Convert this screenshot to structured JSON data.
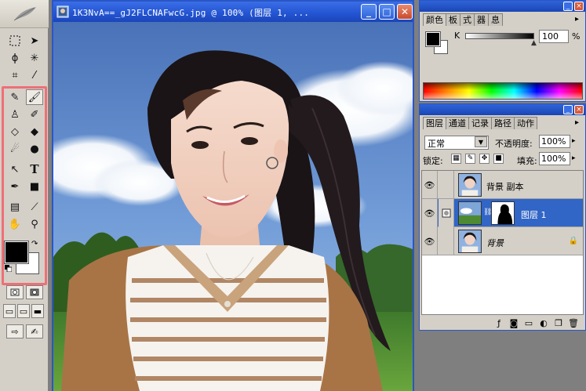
{
  "document": {
    "title": "1K3NvA==_gJ2FLCNAFwcG.jpg @ 100% (图层 1, ..."
  },
  "window_buttons": {
    "minimize": "_",
    "maximize": "□",
    "close": "✕"
  },
  "color_palette": {
    "tabs": [
      "颜色",
      "板",
      "式",
      "器",
      "息"
    ],
    "channel_label": "K",
    "value": "100",
    "unit": "%"
  },
  "layers_palette": {
    "tabs": [
      "图层",
      "通道",
      "记录",
      "路径",
      "动作"
    ],
    "blend_mode": "正常",
    "opacity_label": "不透明度:",
    "opacity_value": "100%",
    "lock_label": "锁定:",
    "fill_label": "填充:",
    "fill_value": "100%",
    "layers": [
      {
        "name": "背景 副本",
        "visible": true,
        "active": false,
        "locked": false
      },
      {
        "name": "图层 1",
        "visible": true,
        "active": true,
        "locked": false,
        "has_mask": true
      },
      {
        "name": "背景",
        "visible": true,
        "active": false,
        "locked": true
      }
    ]
  },
  "colors": {
    "title_bar": "#2354d2",
    "panel_bg": "#d4d0c8",
    "selected_layer": "#3165c6",
    "tools_highlight": "#ef6f76"
  }
}
